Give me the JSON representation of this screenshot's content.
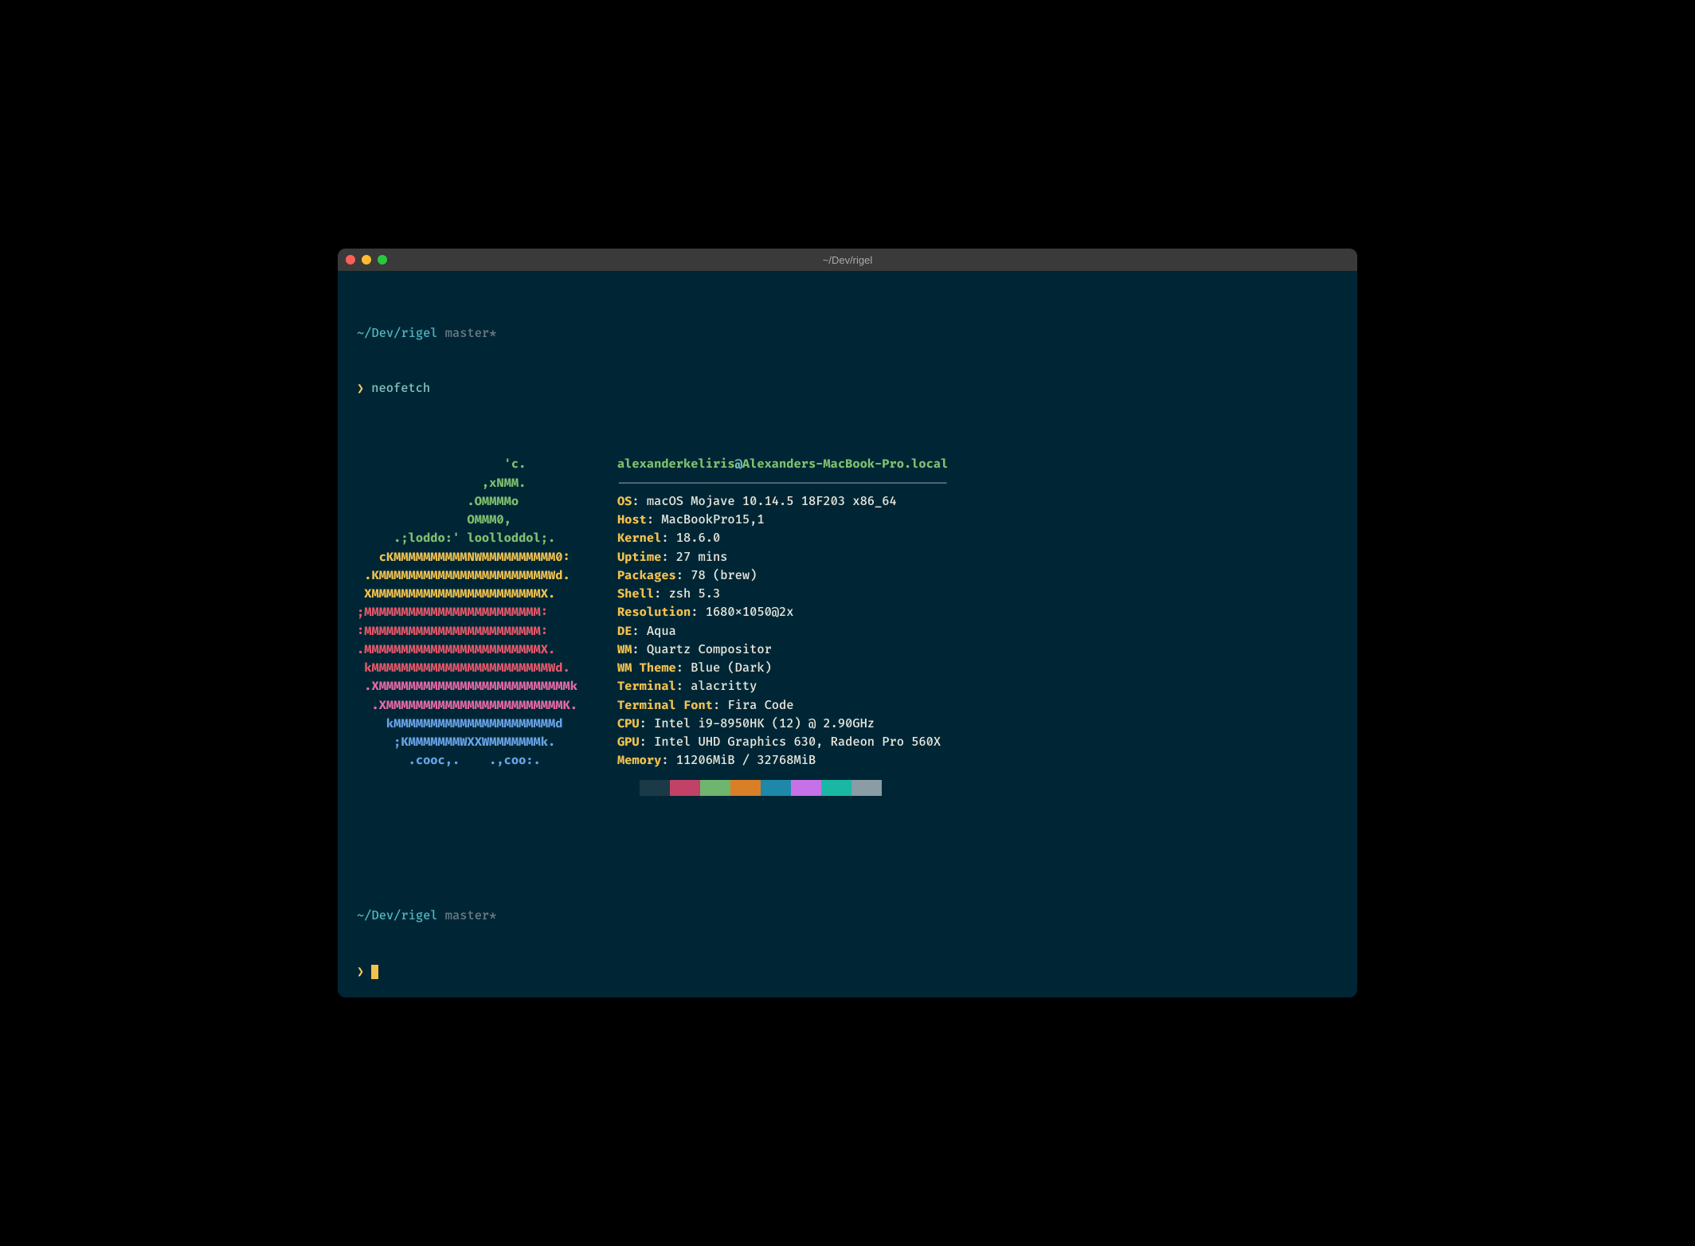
{
  "window": {
    "title": "~/Dev/rigel"
  },
  "prompt1": {
    "path": "~/Dev/rigel",
    "branch": "master*",
    "arrow": "❯",
    "command": "neofetch"
  },
  "prompt2": {
    "path": "~/Dev/rigel",
    "branch": "master*",
    "arrow": "❯"
  },
  "ascii": {
    "l1": "                    'c.",
    "l2": "                 ,xNMM.",
    "l3": "               .OMMMMo",
    "l4": "               OMMM0,",
    "l5": "     .;loddo:' loolloddol;.",
    "l6": "   cKMMMMMMMMMMNWMMMMMMMMMM0:",
    "l7": " .KMMMMMMMMMMMMMMMMMMMMMMMWd.",
    "l8": " XMMMMMMMMMMMMMMMMMMMMMMMX.",
    "l9": ";MMMMMMMMMMMMMMMMMMMMMMMM:",
    "l10": ":MMMMMMMMMMMMMMMMMMMMMMMM:",
    "l11": ".MMMMMMMMMMMMMMMMMMMMMMMMX.",
    "l12": " kMMMMMMMMMMMMMMMMMMMMMMMMWd.",
    "l13": " .XMMMMMMMMMMMMMMMMMMMMMMMMMMk",
    "l14": "  .XMMMMMMMMMMMMMMMMMMMMMMMMK.",
    "l15": "    kMMMMMMMMMMMMMMMMMMMMMMd",
    "l16": "     ;KMMMMMMMWXXWMMMMMMMk.",
    "l17": "       .cooc,.    .,coo:."
  },
  "info": {
    "user": "alexanderkeliris",
    "at": "@",
    "hostname": "Alexanders-MacBook-Pro.local",
    "separator": "---------------------------------------------",
    "rows": [
      {
        "label": "OS",
        "value": "macOS Mojave 10.14.5 18F203 x86_64"
      },
      {
        "label": "Host",
        "value": "MacBookPro15,1"
      },
      {
        "label": "Kernel",
        "value": "18.6.0"
      },
      {
        "label": "Uptime",
        "value": "27 mins"
      },
      {
        "label": "Packages",
        "value": "78 (brew)"
      },
      {
        "label": "Shell",
        "value": "zsh 5.3"
      },
      {
        "label": "Resolution",
        "value": "1680x1050@2x"
      },
      {
        "label": "DE",
        "value": "Aqua"
      },
      {
        "label": "WM",
        "value": "Quartz Compositor"
      },
      {
        "label": "WM Theme",
        "value": "Blue (Dark)"
      },
      {
        "label": "Terminal",
        "value": "alacritty"
      },
      {
        "label": "Terminal Font",
        "value": "Fira Code"
      },
      {
        "label": "CPU",
        "value": "Intel i9-8950HK (12) @ 2.90GHz"
      },
      {
        "label": "GPU",
        "value": "Intel UHD Graphics 630, Radeon Pro 560X"
      },
      {
        "label": "Memory",
        "value": "11206MiB / 32768MiB"
      }
    ]
  },
  "colors": [
    "#1a3a47",
    "#c24267",
    "#6fb46f",
    "#d97f28",
    "#1e88a8",
    "#c671e8",
    "#1ab8a4",
    "#8a9ca4"
  ]
}
